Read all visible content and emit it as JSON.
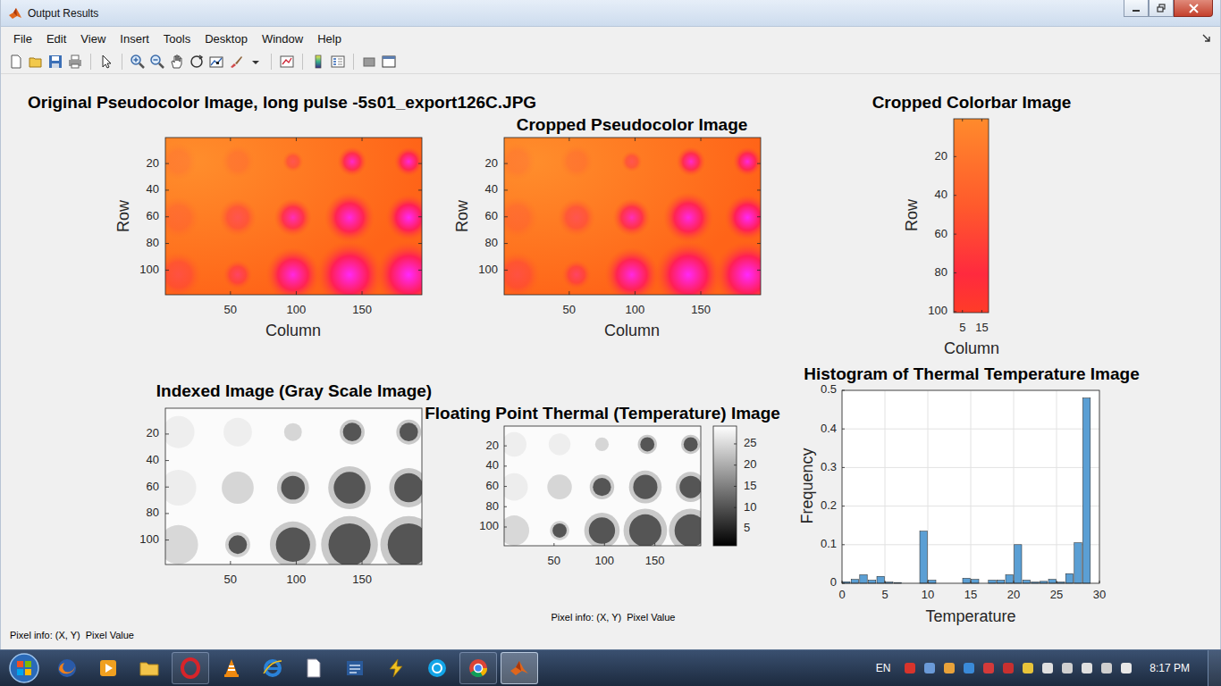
{
  "window": {
    "title": "Output Results"
  },
  "menu": [
    "File",
    "Edit",
    "View",
    "Insert",
    "Tools",
    "Desktop",
    "Window",
    "Help"
  ],
  "figure": {
    "original": {
      "title": "Original Pseudocolor Image, long pulse -5s01_export126C.JPG",
      "x_label": "Column",
      "y_label": "Row",
      "x_ticks": [
        "50",
        "100",
        "150"
      ],
      "y_ticks": [
        "20",
        "40",
        "60",
        "80",
        "100"
      ]
    },
    "cropped": {
      "title": "Cropped Pseudocolor Image",
      "x_label": "Column",
      "y_label": "Row",
      "x_ticks": [
        "50",
        "100",
        "150"
      ],
      "y_ticks": [
        "20",
        "40",
        "60",
        "80",
        "100"
      ]
    },
    "colorbar_crop": {
      "title": "Cropped Colorbar Image",
      "x_label": "Column",
      "y_label": "Row",
      "x_ticks": [
        "5",
        "15"
      ],
      "y_ticks": [
        "20",
        "40",
        "60",
        "80",
        "100"
      ]
    },
    "indexed": {
      "title": "Indexed Image (Gray Scale Image)",
      "x_ticks": [
        "50",
        "100",
        "150"
      ],
      "y_ticks": [
        "20",
        "40",
        "60",
        "80",
        "100"
      ]
    },
    "thermal": {
      "title": "Floating Point Thermal (Temperature) Image",
      "x_ticks": [
        "50",
        "100",
        "150"
      ],
      "y_ticks": [
        "20",
        "40",
        "60",
        "80",
        "100"
      ],
      "colorbar_ticks": [
        "5",
        "10",
        "15",
        "20",
        "25"
      ],
      "pixel_info": "Pixel info: (X, Y)  Pixel Value"
    },
    "histogram": {
      "title": "Histogram of Thermal Temperature Image",
      "x_label": "Temperature",
      "y_label": "Frequency",
      "x_ticks": [
        "0",
        "5",
        "10",
        "15",
        "20",
        "25",
        "30"
      ],
      "y_ticks": [
        "0",
        "0.1",
        "0.2",
        "0.3",
        "0.4",
        "0.5"
      ],
      "values": [
        0.004,
        0.01,
        0.022,
        0.008,
        0.018,
        0.003,
        0.002,
        0.0,
        0.0,
        0.135,
        0.008,
        0.0,
        0.0,
        0.0,
        0.013,
        0.01,
        0.0,
        0.008,
        0.008,
        0.022,
        0.1,
        0.008,
        0.003,
        0.005,
        0.01,
        0.003,
        0.025,
        0.105,
        0.48,
        0.0
      ]
    },
    "spots": [
      {
        "column": 10,
        "row": 18,
        "radius": 9,
        "intensity": 0.1
      },
      {
        "column": 55,
        "row": 18,
        "radius": 8,
        "intensity": 0.12
      },
      {
        "column": 97,
        "row": 18,
        "radius": 5,
        "intensity": 0.35
      },
      {
        "column": 142,
        "row": 18,
        "radius": 7,
        "intensity": 0.75
      },
      {
        "column": 185,
        "row": 18,
        "radius": 7,
        "intensity": 0.8
      },
      {
        "column": 10,
        "row": 60,
        "radius": 10,
        "intensity": 0.15
      },
      {
        "column": 55,
        "row": 60,
        "radius": 9,
        "intensity": 0.35
      },
      {
        "column": 97,
        "row": 60,
        "radius": 9,
        "intensity": 0.7
      },
      {
        "column": 140,
        "row": 60,
        "radius": 12,
        "intensity": 0.85
      },
      {
        "column": 185,
        "row": 60,
        "radius": 11,
        "intensity": 0.95
      },
      {
        "column": 10,
        "row": 103,
        "radius": 11,
        "intensity": 0.3
      },
      {
        "column": 55,
        "row": 103,
        "radius": 7,
        "intensity": 0.45
      },
      {
        "column": 97,
        "row": 103,
        "radius": 13,
        "intensity": 0.85
      },
      {
        "column": 140,
        "row": 103,
        "radius": 16,
        "intensity": 0.95
      },
      {
        "column": 185,
        "row": 103,
        "radius": 16,
        "intensity": 1.0
      }
    ],
    "pixel_info": "Pixel info: (X, Y)  Pixel Value"
  },
  "taskbar": {
    "apps": [
      {
        "kind": "firefox",
        "running": false,
        "selected": false
      },
      {
        "kind": "media",
        "running": false,
        "selected": false
      },
      {
        "kind": "folder",
        "running": false,
        "selected": false
      },
      {
        "kind": "opera",
        "running": true,
        "selected": false
      },
      {
        "kind": "vlc",
        "running": false,
        "selected": false
      },
      {
        "kind": "ie",
        "running": false,
        "selected": false
      },
      {
        "kind": "notepad",
        "running": false,
        "selected": false
      },
      {
        "kind": "app",
        "running": false,
        "selected": false
      },
      {
        "kind": "winamp",
        "running": false,
        "selected": false
      },
      {
        "kind": "skype",
        "running": false,
        "selected": false
      },
      {
        "kind": "chrome",
        "running": true,
        "selected": false
      },
      {
        "kind": "matlab",
        "running": true,
        "selected": true
      }
    ],
    "language": "EN",
    "clock": "8:17 PM"
  }
}
